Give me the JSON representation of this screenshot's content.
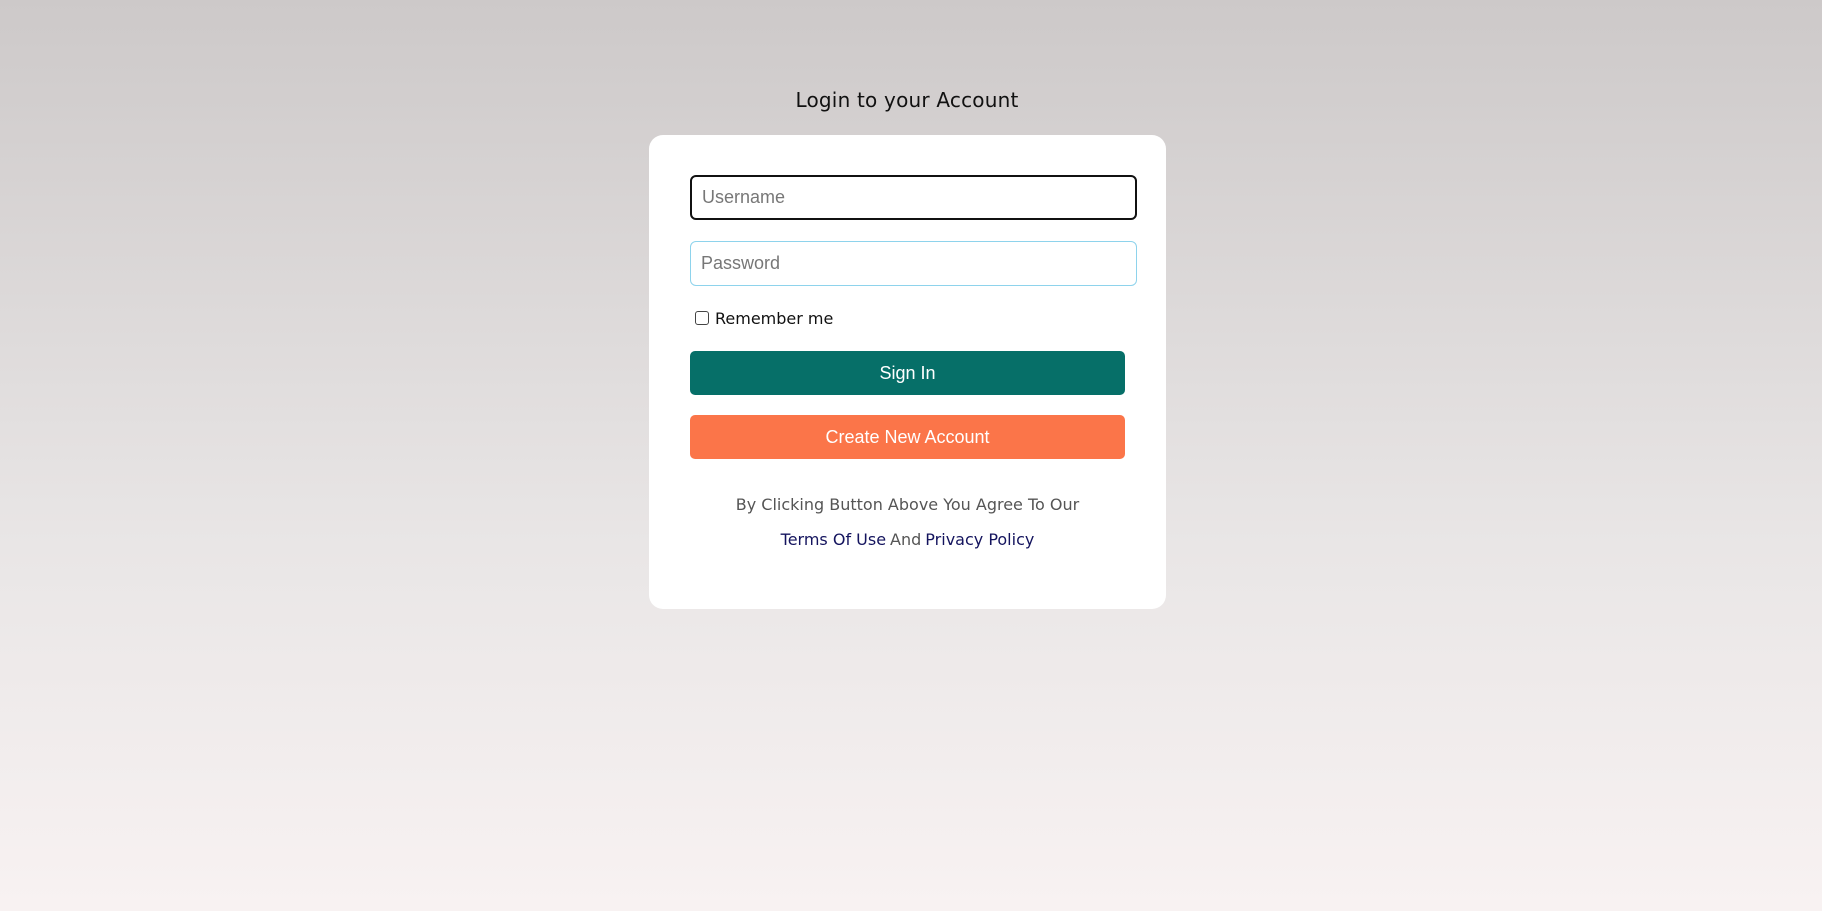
{
  "page": {
    "title": "Login to your Account"
  },
  "form": {
    "username": {
      "placeholder": "Username",
      "value": ""
    },
    "password": {
      "placeholder": "Password",
      "value": ""
    },
    "remember": {
      "label": "Remember me",
      "checked": false
    },
    "sign_in_label": "Sign In",
    "create_account_label": "Create New Account"
  },
  "legal": {
    "agree_text": "By Clicking Button Above You Agree To Our",
    "terms_label": "Terms Of Use",
    "and_text": "And",
    "privacy_label": "Privacy Policy"
  },
  "colors": {
    "sign_in_bg": "#066f68",
    "create_account_bg": "#fb7549",
    "link": "#14145e"
  }
}
